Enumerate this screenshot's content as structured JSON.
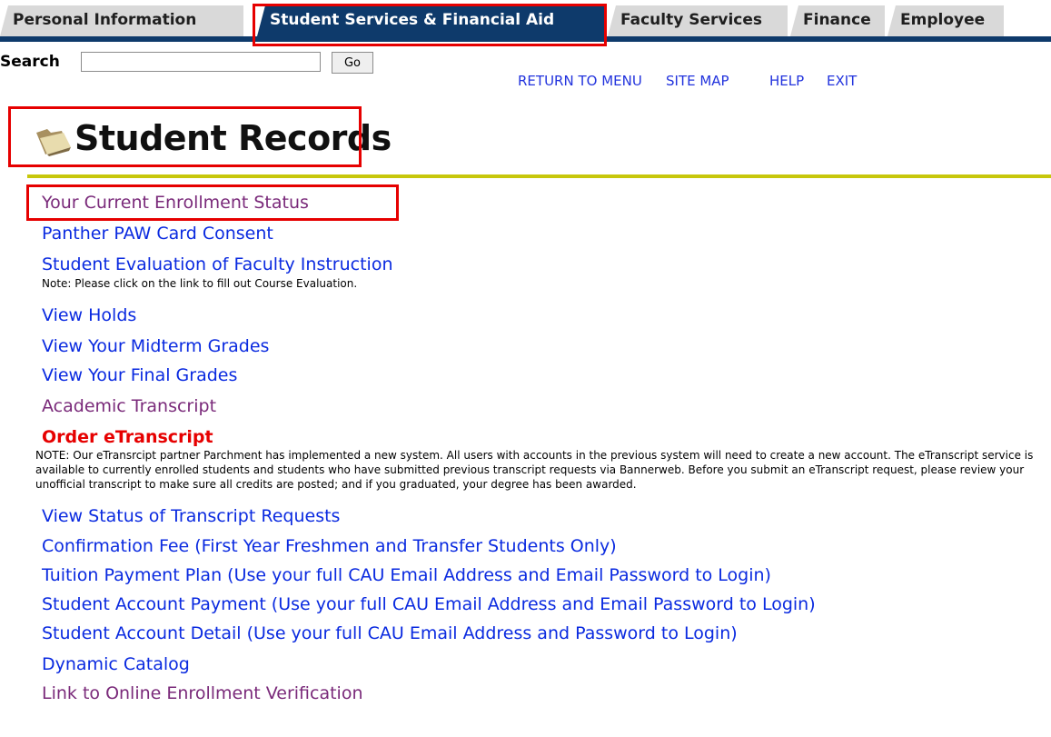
{
  "tabs": [
    {
      "label": "Personal Information",
      "active": false
    },
    {
      "label": "Student Services & Financial Aid",
      "active": true
    },
    {
      "label": "Faculty Services",
      "active": false
    },
    {
      "label": "Finance",
      "active": false
    },
    {
      "label": "Employee",
      "active": false
    }
  ],
  "search": {
    "label": "Search",
    "value": "",
    "go_label": "Go"
  },
  "toplinks": {
    "return": "RETURN TO MENU",
    "sitemap": "SITE MAP",
    "help": "HELP",
    "exit": "EXIT"
  },
  "header": {
    "title": "Student Records",
    "icon": "folder-icon"
  },
  "links": {
    "enrollment": "Your Current Enrollment Status",
    "paw": "Panther PAW Card Consent",
    "evaluation": "Student Evaluation of Faculty Instruction",
    "evaluation_note": "Note: Please click on the link to fill out Course Evaluation.",
    "holds": "View Holds",
    "midterm": "View Your Midterm Grades",
    "final": "View Your Final Grades",
    "transcript": "Academic Transcript",
    "order": "Order eTranscript",
    "order_note": "NOTE: Our eTransrcipt partner Parchment has implemented a new system. All users with accounts in the previous system will need to create a new account. The eTranscript service is available to currently enrolled students and students who have submitted previous transcript requests via Bannerweb. Before you submit an eTranscript request, please review your unofficial transcript to make sure all credits are posted; and if you graduated, your degree has been awarded.",
    "status": "View Status of Transcript Requests",
    "confirmation": "Confirmation Fee (First Year Freshmen and Transfer Students Only)",
    "tuition": "Tuition Payment Plan (Use your full CAU Email Address and Email Password to Login)",
    "payment": "Student Account Payment (Use your full CAU Email Address and Email Password to Login)",
    "detail": "Student Account Detail (Use your full CAU Email Address and Password to Login)",
    "catalog": "Dynamic Catalog",
    "verification": "Link to Online Enrollment Verification"
  },
  "colors": {
    "navy": "#0e3a6b",
    "highlight": "#e60000",
    "rule": "#c7c70b",
    "link": "#0a2ae0",
    "visited": "#7a2a7a"
  }
}
